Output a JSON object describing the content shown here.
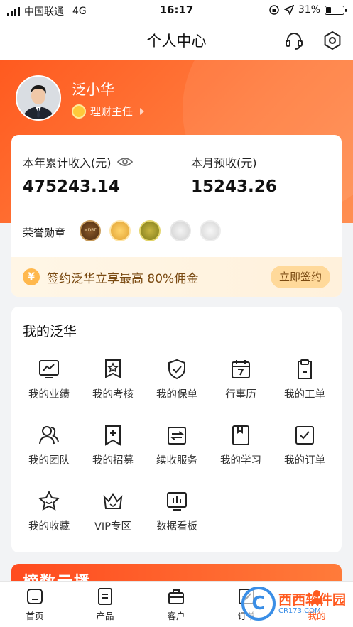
{
  "status_bar": {
    "carrier": "中国联通",
    "network": "4G",
    "time": "16:17",
    "battery": "31%",
    "battery_level": 0.31
  },
  "nav": {
    "title": "个人中心",
    "support_icon": "headset-icon",
    "settings_icon": "hexagon-gear-icon"
  },
  "profile": {
    "name": "泛小华",
    "role": "理财主任"
  },
  "income": {
    "year_label": "本年累计收入(元)",
    "year_value": "475243.14",
    "month_label": "本月预收(元)",
    "month_value": "15243.26"
  },
  "honor": {
    "label": "荣誉勋章",
    "medals": [
      "MDRT",
      "",
      "",
      "",
      ""
    ]
  },
  "promo": {
    "coin": "¥",
    "text": "签约泛华立享最高 80%佣金",
    "button": "立即签约"
  },
  "my_section": {
    "title": "我的泛华",
    "items": [
      {
        "label": "我的业绩",
        "icon": "chart-monitor-icon"
      },
      {
        "label": "我的考核",
        "icon": "star-badge-icon"
      },
      {
        "label": "我的保单",
        "icon": "shield-check-icon"
      },
      {
        "label": "行事历",
        "icon": "calendar-icon"
      },
      {
        "label": "我的工单",
        "icon": "clipboard-icon"
      },
      {
        "label": "我的团队",
        "icon": "team-icon"
      },
      {
        "label": "我的招募",
        "icon": "add-bookmark-icon"
      },
      {
        "label": "续收服务",
        "icon": "renew-icon"
      },
      {
        "label": "我的学习",
        "icon": "book-icon"
      },
      {
        "label": "我的订单",
        "icon": "order-check-icon"
      },
      {
        "label": "我的收藏",
        "icon": "star-icon"
      },
      {
        "label": "VIP专区",
        "icon": "crown-icon"
      },
      {
        "label": "数据看板",
        "icon": "dashboard-icon"
      }
    ]
  },
  "banner": {
    "text": "榜数云播"
  },
  "tabbar": {
    "tabs": [
      {
        "label": "首页",
        "icon": "home-icon"
      },
      {
        "label": "产品",
        "icon": "product-icon"
      },
      {
        "label": "客户",
        "icon": "client-icon"
      },
      {
        "label": "订单",
        "icon": "order-icon"
      },
      {
        "label": "我的",
        "icon": "me-icon"
      }
    ]
  },
  "watermark": {
    "name": "西西软件园",
    "url": "CR173.COM"
  },
  "colors": {
    "accent": "#ff5a1f",
    "gold": "#7a4a12"
  }
}
